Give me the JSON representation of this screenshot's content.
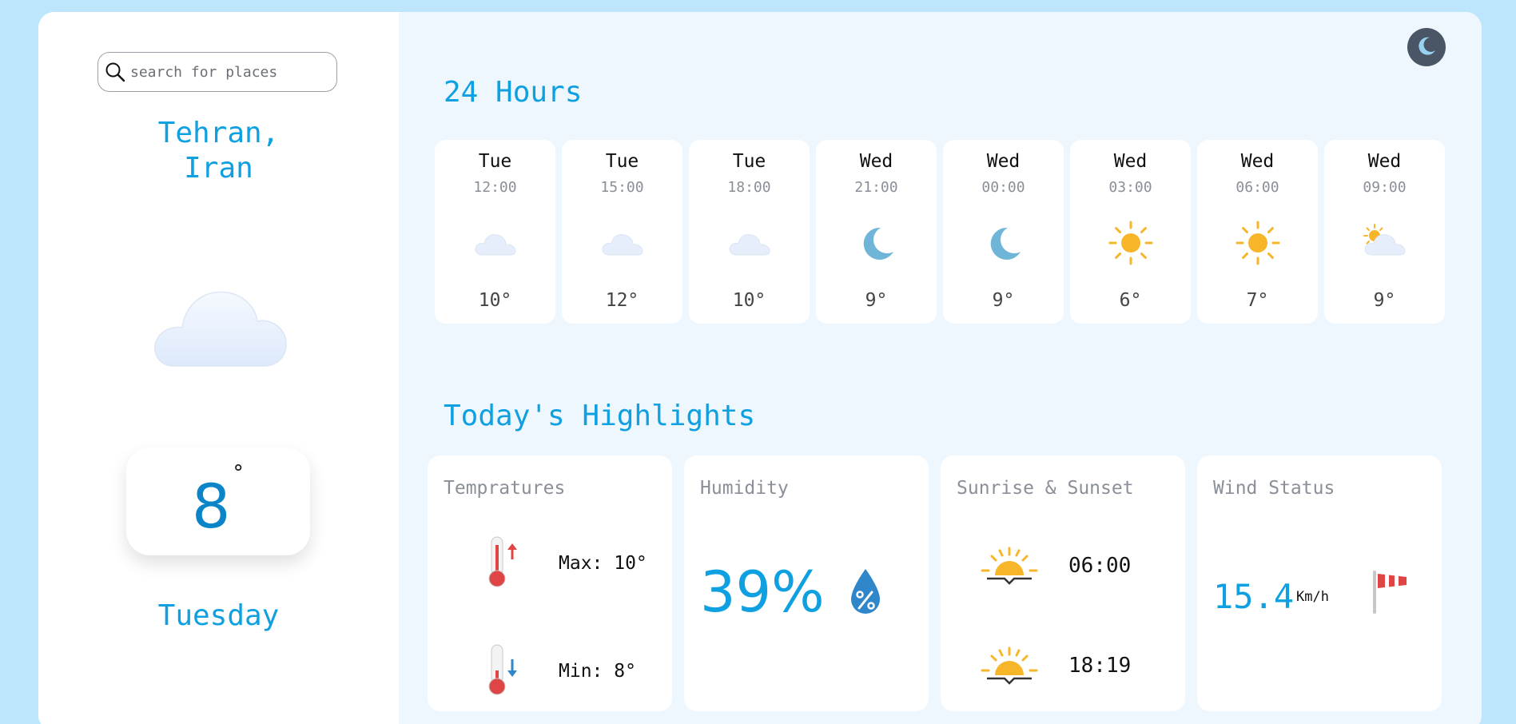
{
  "search": {
    "placeholder": "search for places"
  },
  "location": {
    "line1": "Tehran,",
    "line2": "Iran"
  },
  "current": {
    "temperature": "8",
    "degree_symbol": "°",
    "day": "Tuesday",
    "icon": "cloud-icon"
  },
  "theme_toggle": {
    "icon": "moon-icon"
  },
  "sections": {
    "hourly_title": "24 Hours",
    "highlights_title": "Today's Highlights"
  },
  "hourly": [
    {
      "day": "Tue",
      "time": "12:00",
      "temp": "10°",
      "icon": "cloud-icon"
    },
    {
      "day": "Tue",
      "time": "15:00",
      "temp": "12°",
      "icon": "cloud-icon"
    },
    {
      "day": "Tue",
      "time": "18:00",
      "temp": "10°",
      "icon": "cloud-icon"
    },
    {
      "day": "Wed",
      "time": "21:00",
      "temp": "9°",
      "icon": "moon-icon"
    },
    {
      "day": "Wed",
      "time": "00:00",
      "temp": "9°",
      "icon": "moon-icon"
    },
    {
      "day": "Wed",
      "time": "03:00",
      "temp": "6°",
      "icon": "sun-icon"
    },
    {
      "day": "Wed",
      "time": "06:00",
      "temp": "7°",
      "icon": "sun-icon"
    },
    {
      "day": "Wed",
      "time": "09:00",
      "temp": "9°",
      "icon": "partly-cloudy-icon"
    }
  ],
  "highlights": {
    "temperatures": {
      "title": "Tempratures",
      "max": "Max: 10°",
      "min": "Min: 8°"
    },
    "humidity": {
      "title": "Humidity",
      "value": "39%"
    },
    "sun": {
      "title": "Sunrise & Sunset",
      "sunrise": "06:00",
      "sunset": "18:19"
    },
    "wind": {
      "title": "Wind Status",
      "value": "15.4",
      "unit": "Km/h"
    }
  },
  "colors": {
    "accent": "#0ea0e0",
    "background": "#bde6fd",
    "main_panel": "#eef7fe"
  }
}
